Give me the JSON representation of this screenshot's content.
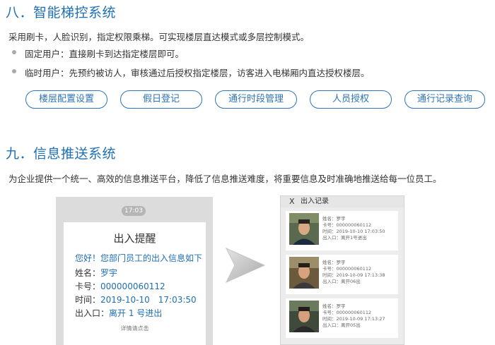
{
  "section8": {
    "title": "八．智能梯控系统",
    "intro": "采用刷卡，人脸识别，指定权限乘梯。可实现楼层直达模式或多层控制模式。",
    "bullets": [
      "固定用户：直接刷卡到达指定楼层即可。",
      "临时用户：先预约被访人，审核通过后授权指定楼层，访客进入电梯厢内直达授权楼层。"
    ],
    "buttons": [
      "楼层配置设置",
      "假日登记",
      "通行时段管理",
      "人员授权",
      "通行记录查询"
    ]
  },
  "section9": {
    "title": "九．信息推送系统",
    "intro": "为企业提供一个统一、高效的信息推送平台，降低了信息推送难度，将重要信息及时准确地推送给每一位员工。"
  },
  "phone": {
    "time": "17:03",
    "card_title": "出入提醒",
    "greeting": "您好！您部门员工的出入信息如下",
    "name_label": "姓名：",
    "name_value": "罗宇",
    "card_label": "卡号：",
    "card_value": "000000060112",
    "time_label": "时间：",
    "time_value": "2019-10-10　17:03:50",
    "door_label": "出入口：",
    "door_value": "离开 1 号进出",
    "details_link": "详情请点击"
  },
  "record_panel": {
    "close_glyph": "X",
    "title": "出入记录",
    "records": [
      {
        "name": "姓名：罗宇",
        "card": "卡号：000000060112",
        "time": "时间：2019-10-10 17:03:50",
        "door": "出入口：离开1号进出"
      },
      {
        "name": "姓名：罗宇",
        "card": "卡号：000000060112",
        "time": "时间：2019-10-09 17:13:38",
        "door": "出入口：离开06出"
      },
      {
        "name": "姓名：罗宇",
        "card": "卡号：000000060112",
        "time": "时间：2019-10-09 17:13:27",
        "door": "出入口：离开05出"
      }
    ]
  },
  "colors": {
    "title_blue": "#1e6fb5",
    "button_border": "#2d74b8",
    "phone_bg": "#dcdcdc",
    "panel_bg": "#ececec"
  }
}
